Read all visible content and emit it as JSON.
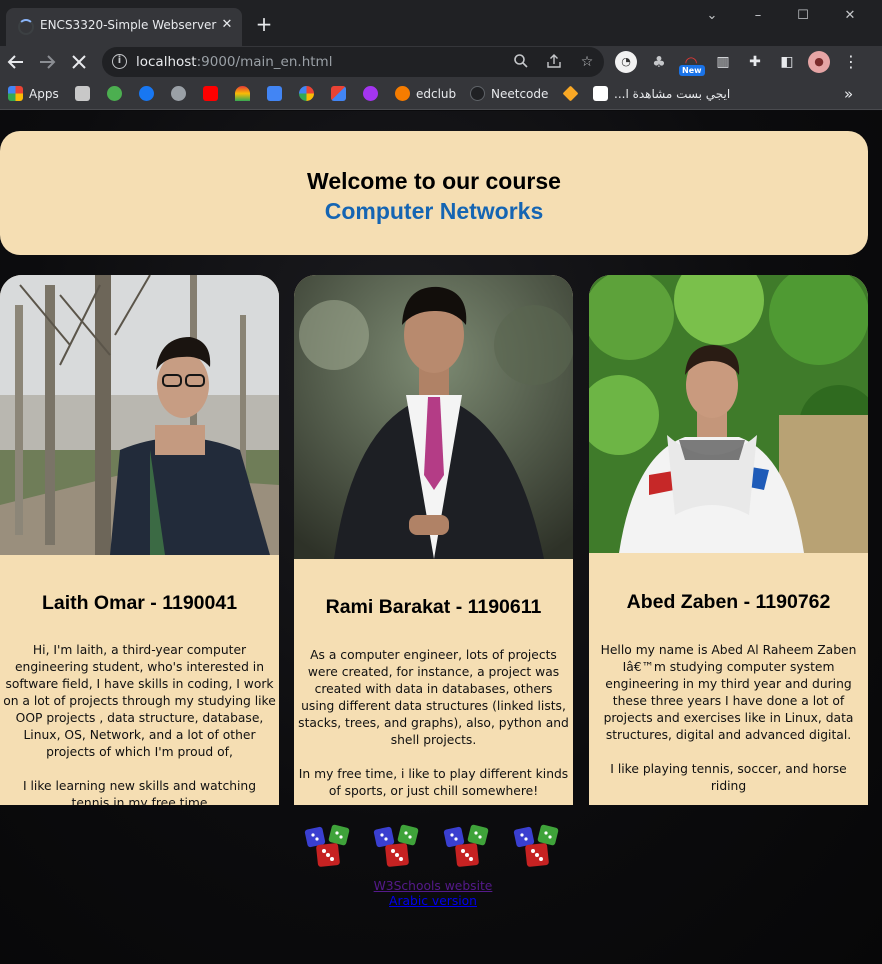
{
  "browser": {
    "tab_title": "ENCS3320-Simple Webserver",
    "tab_close_glyph": "✕",
    "new_tab_glyph": "+",
    "url_host": "localhost",
    "url_rest": ":9000/main_en.html",
    "window_controls": [
      "⌄",
      "–",
      "☐",
      "✕"
    ],
    "extension_badge": "New"
  },
  "bookmarks": [
    {
      "label": "Apps",
      "icon": "apps-grid-icon",
      "color": "#ea4335"
    },
    {
      "label": "",
      "icon": "bookmark-icon-1",
      "color": "#9aa0a6"
    },
    {
      "label": "",
      "icon": "tree-icon",
      "color": "#4caf50"
    },
    {
      "label": "",
      "icon": "facebook-icon",
      "color": "#1877f2"
    },
    {
      "label": "",
      "icon": "globe-icon",
      "color": "#9aa0a6"
    },
    {
      "label": "",
      "icon": "youtube-icon",
      "color": "#ff0000"
    },
    {
      "label": "",
      "icon": "wifi-icon",
      "color": "#e53935"
    },
    {
      "label": "",
      "icon": "translate-icon",
      "color": "#4285f4"
    },
    {
      "label": "",
      "icon": "google-icon",
      "color": "#ffffff"
    },
    {
      "label": "",
      "icon": "gmail-icon",
      "color": "#ea4335"
    },
    {
      "label": "",
      "icon": "udemy-icon",
      "color": "#a435f0"
    },
    {
      "label": "edclub",
      "icon": "edclub-icon",
      "color": "#f57c00"
    },
    {
      "label": "Neetcode",
      "icon": "neetcode-icon",
      "color": "#3c4043"
    },
    {
      "label": "",
      "icon": "bookmark-icon-2",
      "color": "#f9a825"
    },
    {
      "label": "ايجي بست مشاهدة ا...",
      "icon": "egybest-icon",
      "color": "#ffffff"
    }
  ],
  "bookmarks_overflow": "»",
  "welcome": {
    "title": "Welcome to our course",
    "subtitle": "Computer Networks"
  },
  "cards": [
    {
      "name": "Laith Omar - 1190041",
      "bio": [
        "Hi, I'm laith, a third-year computer engineering student, who's interested in software field, I have skills in coding, I work on a lot of projects through my studying like OOP projects , data structure, database, Linux, OS, Network, and a lot of other projects of which I'm proud of,",
        "I like learning new skills and watching tennis in my free time"
      ]
    },
    {
      "name": "Rami Barakat - 1190611",
      "bio": [
        "As a computer engineer, lots of projects were created, for instance, a project was created with data in databases, others using different data structures (linked lists, stacks, trees, and graphs), also, python and shell projects.",
        "In my free time, i like to play different kinds of sports, or just chill somewhere!"
      ]
    },
    {
      "name": "Abed Zaben - 1190762",
      "bio": [
        "Hello my name is Abed Al Raheem Zaben Iâ€™m studying computer system engineering in my third year and during these three years I have done a lot of projects and exercises like in Linux, data structures, digital and advanced digital.",
        "I like playing tennis, soccer, and horse riding"
      ]
    }
  ],
  "links": {
    "w3schools": "W3Schools website",
    "arabic": "Arabic version"
  },
  "colors": {
    "card_bg": "#f5deb3",
    "subtitle_blue": "#1565b3",
    "visited_link": "#551a8b",
    "link": "#0000ee"
  }
}
